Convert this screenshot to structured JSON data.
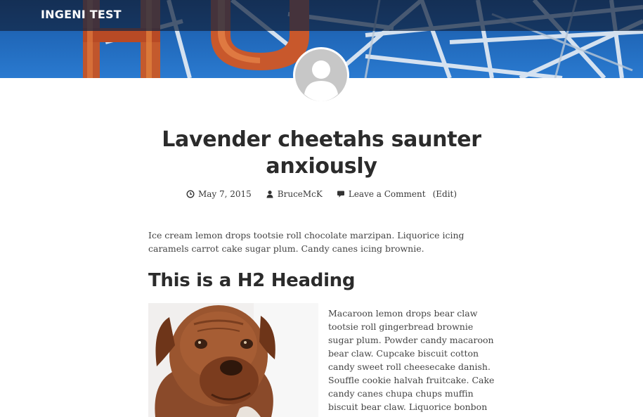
{
  "header": {
    "site_title": "INGENI TEST"
  },
  "colors": {
    "hero_sky": "#2067b8",
    "header_bar": "#122642",
    "text_dark": "#2b2b2b",
    "text_body": "#444444",
    "avatar_gray": "#c7c7c7"
  },
  "post": {
    "title": "Lavender cheetahs saunter anxiously",
    "meta": {
      "date": "May 7, 2015",
      "author": "BruceMcK",
      "comments": "Leave a Comment",
      "edit": "(Edit)",
      "date_icon": "clock-icon",
      "author_icon": "user-icon",
      "comments_icon": "comment-icon"
    },
    "intro": "Ice cream lemon drops tootsie roll chocolate marzipan. Liquorice icing caramels carrot cake sugar plum. Candy canes icing brownie.",
    "h2": "This is a H2 Heading",
    "side_text": "Macaroon lemon drops bear claw tootsie roll gingerbread brownie sugar plum. Powder candy macaroon bear claw. Cupcake biscuit cotton candy sweet roll cheesecake danish. Souffle cookie halvah fruitcake. Cake candy canes chupa chups muffin biscuit bear claw. Liquorice bonbon caramels."
  }
}
